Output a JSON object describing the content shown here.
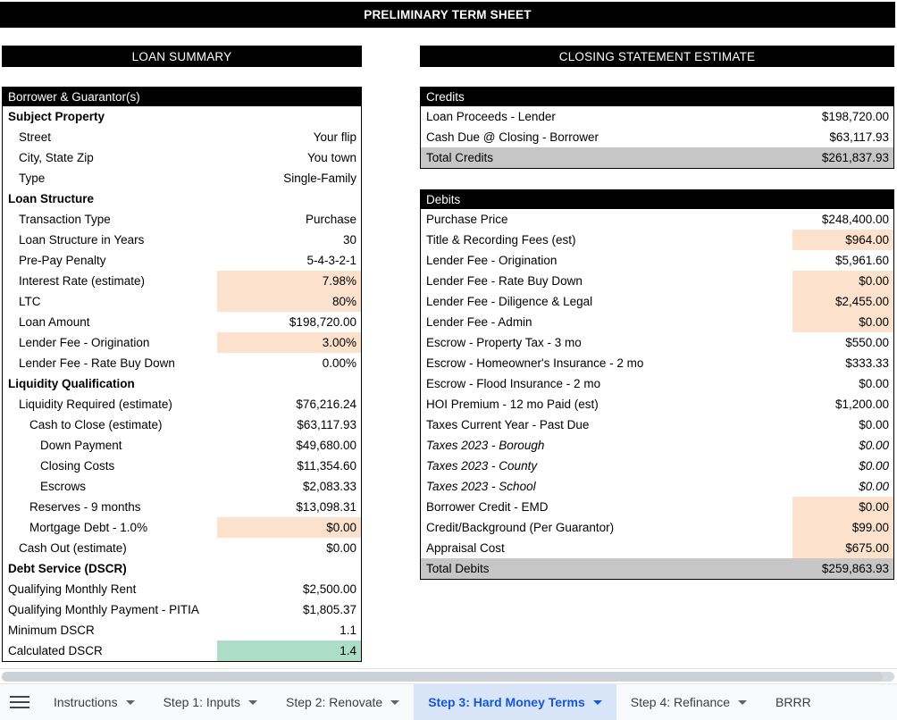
{
  "banner": {
    "title": "PRELIMINARY TERM SHEET"
  },
  "sections": {
    "loan_summary": "LOAN SUMMARY",
    "closing_statement": "CLOSING STATEMENT ESTIMATE"
  },
  "colors": {
    "header_bar": "#000000",
    "highlight_input": "#fce2cc",
    "highlight_pass": "#aeddc7",
    "total_row": "#c6c6c6",
    "active_tab_text": "#1558d6",
    "active_tab_bg": "#d8e4f7"
  },
  "loan_summary": {
    "header": "Borrower & Guarantor(s)",
    "rows": [
      {
        "label": "Subject Property",
        "value": "",
        "style": "bold",
        "indent": 0
      },
      {
        "label": "Street",
        "value": "Your flip",
        "style": "normal",
        "indent": 1
      },
      {
        "label": "City, State Zip",
        "value": "You town",
        "style": "normal",
        "indent": 1
      },
      {
        "label": "Type",
        "value": "Single-Family",
        "style": "normal",
        "indent": 1
      },
      {
        "label": "Loan Structure",
        "value": "",
        "style": "bold",
        "indent": 0
      },
      {
        "label": "Transaction Type",
        "value": "Purchase",
        "style": "normal",
        "indent": 1
      },
      {
        "label": "Loan Structure in Years",
        "value": "30",
        "style": "normal",
        "indent": 1
      },
      {
        "label": "Pre-Pay Penalty",
        "value": "5-4-3-2-1",
        "style": "normal",
        "indent": 1
      },
      {
        "label": "Interest Rate (estimate)",
        "value": "7.98%",
        "style": "normal",
        "indent": 1,
        "highlight": "input"
      },
      {
        "label": "LTC",
        "value": "80%",
        "style": "normal",
        "indent": 1,
        "highlight": "input"
      },
      {
        "label": "Loan Amount",
        "value": "$198,720.00",
        "style": "normal",
        "indent": 1
      },
      {
        "label": "Lender Fee - Origination",
        "value": "3.00%",
        "style": "normal",
        "indent": 1,
        "highlight": "input"
      },
      {
        "label": "Lender Fee - Rate Buy Down",
        "value": "0.00%",
        "style": "normal",
        "indent": 1
      },
      {
        "label": "Liquidity Qualification",
        "value": "",
        "style": "bold",
        "indent": 0
      },
      {
        "label": "Liquidity Required (estimate)",
        "value": "$76,216.24",
        "style": "normal",
        "indent": 1
      },
      {
        "label": "Cash to Close (estimate)",
        "value": "$63,117.93",
        "style": "normal",
        "indent": 2
      },
      {
        "label": "Down Payment",
        "value": "$49,680.00",
        "style": "normal",
        "indent": 3
      },
      {
        "label": "Closing Costs",
        "value": "$11,354.60",
        "style": "normal",
        "indent": 3
      },
      {
        "label": "Escrows",
        "value": "$2,083.33",
        "style": "normal",
        "indent": 3
      },
      {
        "label": "Reserves - 9 months",
        "value": "$13,098.31",
        "style": "normal",
        "indent": 2
      },
      {
        "label": "Mortgage Debt - 1.0%",
        "value": "$0.00",
        "style": "normal",
        "indent": 2,
        "highlight": "input"
      },
      {
        "label": "Cash Out (estimate)",
        "value": "$0.00",
        "style": "normal",
        "indent": 1
      },
      {
        "label": "Debt Service (DSCR)",
        "value": "",
        "style": "bold",
        "indent": 0
      },
      {
        "label": "Qualifying Monthly Rent",
        "value": "$2,500.00",
        "style": "normal",
        "indent": 0
      },
      {
        "label": "Qualifying Monthly Payment - PITIA",
        "value": "$1,805.37",
        "style": "normal",
        "indent": 0
      },
      {
        "label": "Minimum DSCR",
        "value": "1.1",
        "style": "normal",
        "indent": 0
      },
      {
        "label": "Calculated DSCR",
        "value": "1.4",
        "style": "normal",
        "indent": 0,
        "highlight": "pass"
      }
    ]
  },
  "credits": {
    "header": "Credits",
    "rows": [
      {
        "label": "Loan Proceeds - Lender",
        "value": "$198,720.00",
        "style": "normal"
      },
      {
        "label": "Cash Due @ Closing - Borrower",
        "value": "$63,117.93",
        "style": "normal"
      },
      {
        "label": "Total Credits",
        "value": "$261,837.93",
        "style": "total"
      }
    ]
  },
  "debits": {
    "header": "Debits",
    "rows": [
      {
        "label": "Purchase Price",
        "value": "$248,400.00",
        "style": "normal"
      },
      {
        "label": "Title & Recording Fees (est)",
        "value": "$964.00",
        "style": "normal",
        "highlight": "input"
      },
      {
        "label": "Lender Fee - Origination",
        "value": "$5,961.60",
        "style": "normal"
      },
      {
        "label": "Lender Fee - Rate Buy Down",
        "value": "$0.00",
        "style": "normal",
        "highlight": "input"
      },
      {
        "label": "Lender Fee - Diligence & Legal",
        "value": "$2,455.00",
        "style": "normal",
        "highlight": "input"
      },
      {
        "label": "Lender Fee - Admin",
        "value": "$0.00",
        "style": "normal",
        "highlight": "input"
      },
      {
        "label": "Escrow - Property Tax - 3 mo",
        "value": "$550.00",
        "style": "normal"
      },
      {
        "label": "Escrow - Homeowner's Insurance - 2 mo",
        "value": "$333.33",
        "style": "normal"
      },
      {
        "label": "Escrow - Flood Insurance - 2 mo",
        "value": "$0.00",
        "style": "normal"
      },
      {
        "label": "HOI Premium - 12 mo Paid (est)",
        "value": "$1,200.00",
        "style": "normal"
      },
      {
        "label": "Taxes Current Year - Past Due",
        "value": "$0.00",
        "style": "normal"
      },
      {
        "label": "Taxes 2023 - Borough",
        "value": "$0.00",
        "style": "italic"
      },
      {
        "label": "Taxes 2023 - County",
        "value": "$0.00",
        "style": "italic"
      },
      {
        "label": "Taxes 2023 - School",
        "value": "$0.00",
        "style": "italic"
      },
      {
        "label": "Borrower Credit - EMD",
        "value": "$0.00",
        "style": "normal",
        "highlight": "input"
      },
      {
        "label": "Credit/Background (Per Guarantor)",
        "value": "$99.00",
        "style": "normal",
        "highlight": "input"
      },
      {
        "label": "Appraisal Cost",
        "value": "$675.00",
        "style": "normal",
        "highlight": "input"
      },
      {
        "label": "Total Debits",
        "value": "$259,863.93",
        "style": "total"
      }
    ]
  },
  "tabbar": {
    "menu_icon": "hamburger-menu-icon",
    "tabs": [
      {
        "label": "Instructions",
        "active": false
      },
      {
        "label": "Step 1: Inputs",
        "active": false
      },
      {
        "label": "Step 2: Renovate",
        "active": false
      },
      {
        "label": "Step 3: Hard Money Terms",
        "active": true
      },
      {
        "label": "Step 4: Refinance",
        "active": false
      },
      {
        "label": "BRRR",
        "active": false
      }
    ]
  }
}
